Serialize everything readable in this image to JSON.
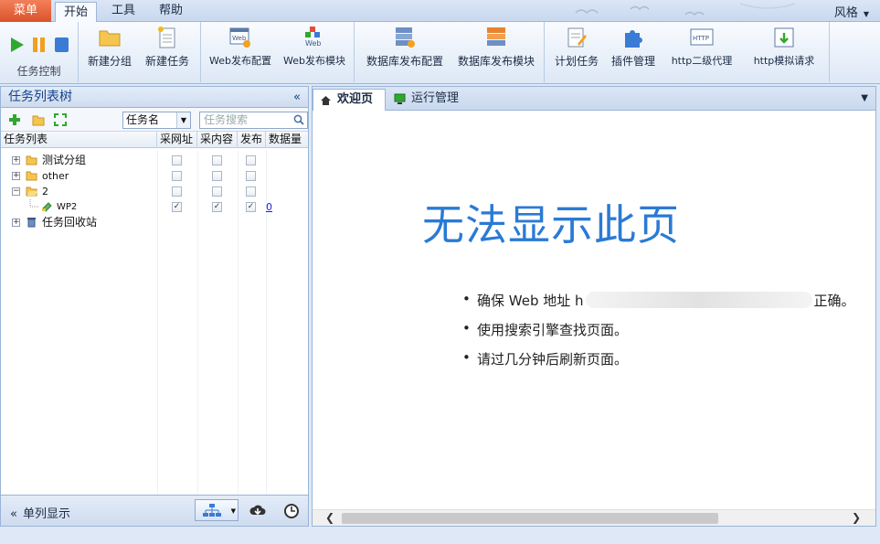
{
  "ribbon_tabs": {
    "menu": "菜单",
    "start": "开始",
    "tools": "工具",
    "help": "帮助",
    "style": "风格"
  },
  "ribbon": {
    "task_control_label": "任务控制",
    "buttons": {
      "new_group": "新建分组",
      "new_task": "新建任务",
      "web_publish_config": "Web发布配置",
      "web_publish_module": "Web发布模块",
      "db_publish_config": "数据库发布配置",
      "db_publish_module": "数据库发布模块",
      "schedule_task": "计划任务",
      "plugin_manage": "插件管理",
      "http_proxy": "http二级代理",
      "http_simulate": "http模拟请求"
    },
    "icon_texts": {
      "web": "Web",
      "http": "HTTP"
    }
  },
  "left_panel": {
    "title": "任务列表树",
    "filter_select": "任务名",
    "search_placeholder": "任务搜索",
    "columns": [
      "任务列表",
      "采网址",
      "采内容",
      "发布",
      "数据量"
    ],
    "rows": [
      {
        "name": "测试分组",
        "type": "folder",
        "url": false,
        "content": false,
        "publish": false,
        "count": ""
      },
      {
        "name": "other",
        "type": "folder",
        "url": false,
        "content": false,
        "publish": false,
        "count": ""
      },
      {
        "name": "2",
        "type": "folder-open",
        "url": false,
        "content": false,
        "publish": false,
        "count": ""
      },
      {
        "name": "WP2",
        "type": "task",
        "url": true,
        "content": true,
        "publish": true,
        "count": "0"
      },
      {
        "name": "任务回收站",
        "type": "trash",
        "url": null,
        "content": null,
        "publish": null,
        "count": ""
      }
    ],
    "bottom": {
      "single_column": "单列显示"
    }
  },
  "right_panel": {
    "tabs": [
      {
        "label": "欢迎页",
        "icon": "home-icon"
      },
      {
        "label": "运行管理",
        "icon": "monitor-icon"
      }
    ],
    "error_title": "无法显示此页",
    "bullet1_pre": "确保 Web 地址 h",
    "bullet1_post": "正确。",
    "bullet2": "使用搜索引擎查找页面。",
    "bullet3": "请过几分钟后刷新页面。"
  },
  "colors": {
    "accent": "#2a7ad5",
    "menu_tab": "#e0643c",
    "play": "#2fa82f",
    "pause": "#f0a020",
    "stop": "#3a7bd5"
  }
}
